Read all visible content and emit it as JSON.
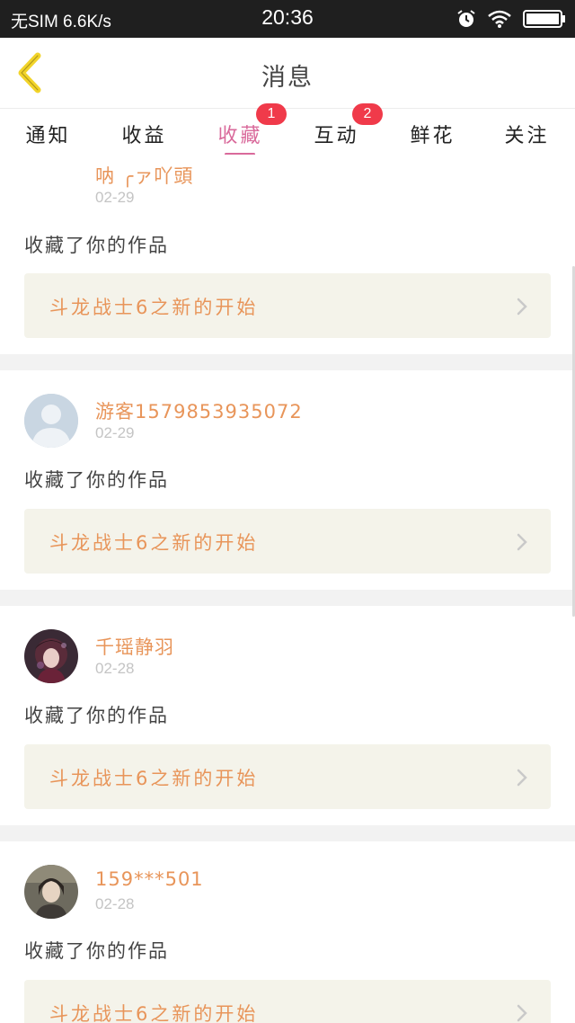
{
  "status_bar": {
    "left_text": "无SIM 6.6K/s",
    "time": "20:36",
    "icons": [
      "alarm-icon",
      "wifi-icon",
      "battery-icon"
    ]
  },
  "header": {
    "title": "消息",
    "back_icon": "chevron-left-icon",
    "accent_color": "#f2d42a"
  },
  "tabs": [
    {
      "label": "通知",
      "badge": ""
    },
    {
      "label": "收益",
      "badge": ""
    },
    {
      "label": "收藏",
      "badge": "1",
      "active": true
    },
    {
      "label": "互动",
      "badge": "2"
    },
    {
      "label": "鲜花",
      "badge": ""
    },
    {
      "label": "关注",
      "badge": ""
    }
  ],
  "colors": {
    "active_tab": "#d96a9b",
    "badge": "#f03a4a",
    "username": "#e8955a",
    "work_box_bg": "#f4f3ea"
  },
  "messages": [
    {
      "username": "呐 ╭ァ吖頭",
      "date": "02-29",
      "action": "收藏了你的作品",
      "work_title": "斗龙战士6之新的开始",
      "avatar": "avatar-hidden"
    },
    {
      "username": "游客15798539350​72",
      "date": "02-29",
      "action": "收藏了你的作品",
      "work_title": "斗龙战士6之新的开始",
      "avatar": "default-user-avatar"
    },
    {
      "username": "千瑶静羽",
      "date": "02-28",
      "action": "收藏了你的作品",
      "work_title": "斗龙战士6之新的开始",
      "avatar": "anime-girl-avatar"
    },
    {
      "username": "159***501",
      "date": "02-28",
      "action": "收藏了你的作品",
      "work_title": "斗龙战士6之新的开始",
      "avatar": "anime-character-avatar"
    }
  ]
}
